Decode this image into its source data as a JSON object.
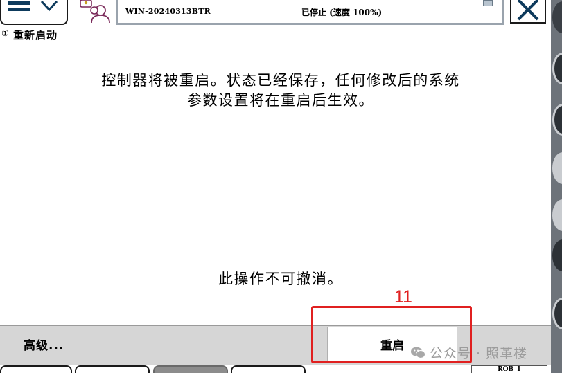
{
  "header": {
    "hostname": "WIN-20240313BTR",
    "status": "已停止 (速度 100%)"
  },
  "page": {
    "title_icon": "①",
    "title": "重新启动"
  },
  "message": {
    "line1": "控制器将被重启。状态已经保存，任何修改后的系统",
    "line2": "参数设置将在重启后生效。",
    "warning": "此操作不可撤消。"
  },
  "actions": {
    "advanced_label": "高级...",
    "restart_label": "重启"
  },
  "annotation": {
    "step_number": "11",
    "color": "#e02020"
  },
  "taskbar": {
    "pos_label": "ROB_1"
  },
  "watermark": {
    "text": "公众号 · 照革楼"
  },
  "icons": {
    "menu": "hamburger-icon",
    "menu_arrow": "chevron-down-icon",
    "user": "user-info-icon",
    "close": "close-icon",
    "title": "info-icon",
    "watermark": "wechat-icon"
  },
  "colors": {
    "accent": "#0d3a5c",
    "bottom_bar": "#d6d6d6",
    "side_panel": "#6d737a"
  }
}
